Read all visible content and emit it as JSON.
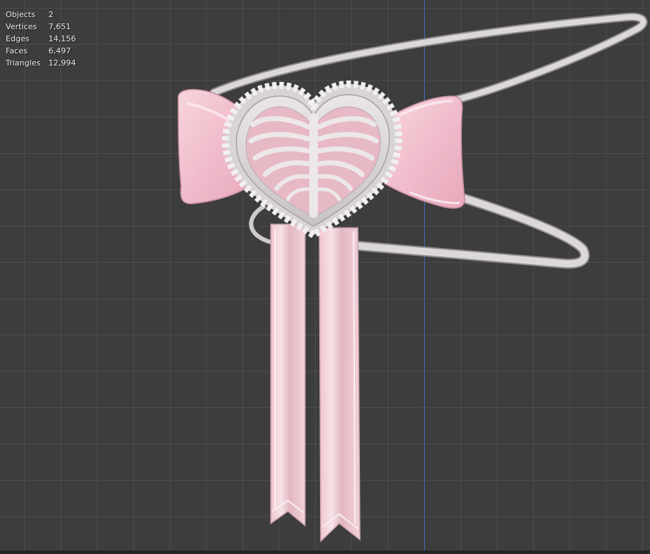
{
  "viewport": {
    "grid_color": "#4a4a4a",
    "background": "#3d3d3d",
    "axis_color": "#3c6fb8"
  },
  "stats": [
    {
      "label": "Objects",
      "value": "2"
    },
    {
      "label": "Vertices",
      "value": "7,651"
    },
    {
      "label": "Edges",
      "value": "14,156"
    },
    {
      "label": "Faces",
      "value": "6,497"
    },
    {
      "label": "Triangles",
      "value": "12,994"
    }
  ],
  "model": {
    "name": "heart-ribcage-bow-headband",
    "colors": {
      "pink": "#f2c3cf",
      "white": "#e4e0e2",
      "shadow": "#a99fa3"
    }
  }
}
